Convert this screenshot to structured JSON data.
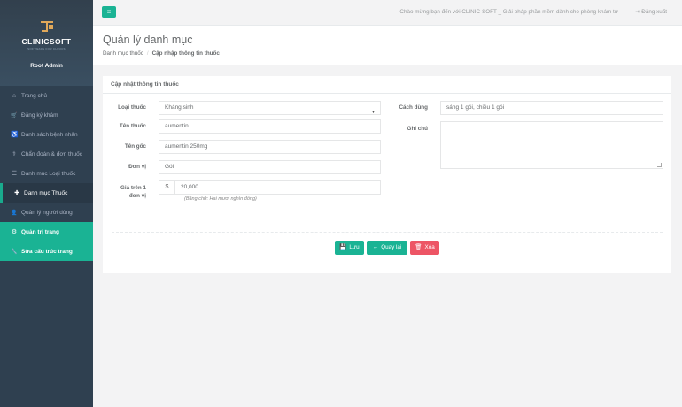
{
  "brand": {
    "name": "CLINICSOFT",
    "tagline": "SOFTWARE FOR CLINICS"
  },
  "user": {
    "name": "Root Admin"
  },
  "nav": [
    {
      "label": "Trang chủ",
      "icon": "home-icon",
      "glyph": "⌂"
    },
    {
      "label": "Đăng ký khám",
      "icon": "cart-icon",
      "glyph": "🛒"
    },
    {
      "label": "Danh sách bệnh nhân",
      "icon": "wheelchair-icon",
      "glyph": "♿"
    },
    {
      "label": "Chẩn đoán & đơn thuốc",
      "icon": "stethoscope-icon",
      "glyph": "⚕"
    },
    {
      "label": "Danh mục Loại thuốc",
      "icon": "list-icon",
      "glyph": "☰"
    },
    {
      "label": "Danh mục Thuốc",
      "icon": "medkit-icon",
      "glyph": "✚"
    },
    {
      "label": "Quản lý người dùng",
      "icon": "user-icon",
      "glyph": "👤"
    },
    {
      "label": "Quản trị trang",
      "icon": "gear-icon",
      "glyph": "⚙"
    },
    {
      "label": "Sửa cấu trúc trang",
      "icon": "wrench-icon",
      "glyph": "🔧"
    }
  ],
  "topbar": {
    "menu_glyph": "≡",
    "welcome": "Chào mừng bạn đến với CLINIC-SOFT _ Giải pháp phần mềm dành cho phòng khám tư",
    "logout": "Đăng xuất",
    "logout_glyph": "⇥"
  },
  "heading": {
    "title": "Quản lý danh mục",
    "crumb_parent": "Danh mục thuốc",
    "crumb_sep": "/",
    "crumb_current": "Cập nhập thông tin thuốc"
  },
  "panel": {
    "title": "Cập nhật thông tin thuốc",
    "fields": {
      "loai_thuoc": {
        "label": "Loại thuốc",
        "value": "Kháng sinh",
        "caret": "▼"
      },
      "ten_thuoc": {
        "label": "Tên thuốc",
        "value": "aumentin"
      },
      "ten_goc": {
        "label": "Tên gốc",
        "value": "aumentin 250mg"
      },
      "don_vi": {
        "label": "Đơn vị",
        "value": "Gói"
      },
      "gia": {
        "label": "Giá trên 1 đơn vị",
        "currency": "$",
        "value": "20,000",
        "hint": "(Bằng chữ: Hai mươi nghìn đồng)"
      },
      "cach_dung": {
        "label": "Cách dùng",
        "value": "sáng 1 gói, chiều 1 gói"
      },
      "ghi_chu": {
        "label": "Ghi chú",
        "value": ""
      }
    },
    "buttons": {
      "save": {
        "label": "Lưu",
        "glyph": "💾"
      },
      "back": {
        "label": "Quay lại",
        "glyph": "←"
      },
      "delete": {
        "label": "Xóa",
        "glyph": "🗑"
      }
    }
  },
  "colors": {
    "sidebar": "#2f4050",
    "accent": "#1ab394",
    "danger": "#ed5565"
  }
}
